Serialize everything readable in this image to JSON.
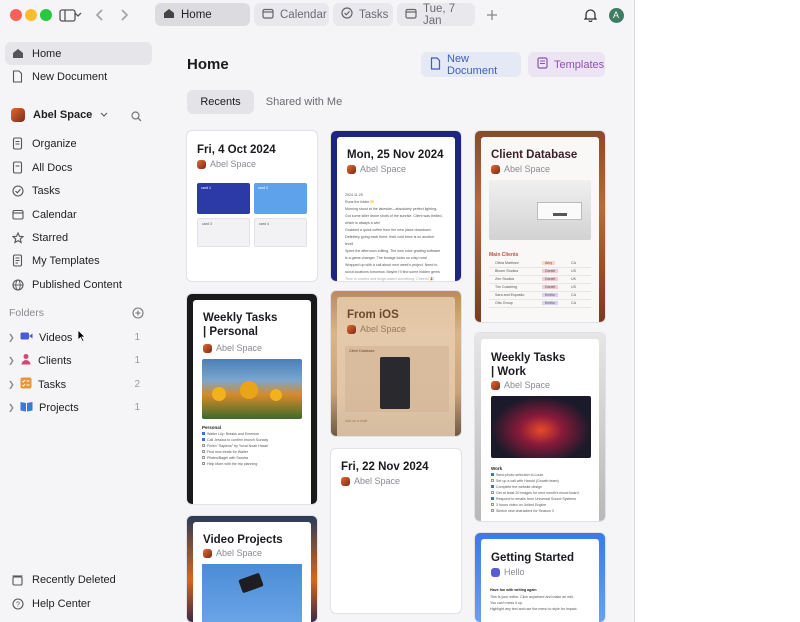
{
  "tabs": [
    {
      "label": "Home",
      "icon": "house-icon"
    },
    {
      "label": "Calendar",
      "icon": "calendar-icon"
    },
    {
      "label": "Tasks",
      "icon": "check-circle-icon"
    },
    {
      "label": "Tue, 7 Jan",
      "icon": "calendar-icon"
    }
  ],
  "avatar_initial": "A",
  "sidebar": {
    "top": [
      {
        "label": "Home"
      },
      {
        "label": "New Document"
      }
    ],
    "space": {
      "label": "Abel Space"
    },
    "nav": [
      {
        "label": "Organize"
      },
      {
        "label": "All Docs"
      },
      {
        "label": "Tasks"
      },
      {
        "label": "Calendar"
      },
      {
        "label": "Starred"
      },
      {
        "label": "My Templates"
      },
      {
        "label": "Published Content"
      }
    ],
    "folders_heading": "Folders",
    "folders": [
      {
        "label": "Videos",
        "count": "1",
        "color": "#4a5bd6"
      },
      {
        "label": "Clients",
        "count": "1",
        "color": "#d6457a"
      },
      {
        "label": "Tasks",
        "count": "2",
        "color": "#e8963a"
      },
      {
        "label": "Projects",
        "count": "1",
        "color": "#3a7ad6"
      }
    ],
    "bottom": [
      {
        "label": "Recently Deleted"
      },
      {
        "label": "Help Center"
      }
    ]
  },
  "main": {
    "title": "Home",
    "new_document": "New Document",
    "templates": "Templates",
    "segments": [
      "Recents",
      "Shared with Me"
    ]
  },
  "cards": {
    "c1": {
      "title": "Fri, 4 Oct 2024",
      "space": "Abel Space",
      "labels": [
        "card 1",
        "card 2",
        "card 3",
        "card 4"
      ]
    },
    "c2": {
      "title": "Mon, 25 Nov 2024",
      "space": "Abel Space",
      "lines": [
        "2024.11.25",
        "Runs the folder 📁",
        "Morning shoot at the lakeside—absolutely perfect lighting.",
        "Got some killer drone shots of the sunrise. Client was thrilled,",
        "which is always a win!",
        "Grabbed a quick coffee from the new place downtown.",
        "Definitely going back there, their cold brew is on another",
        "level!",
        "Spent the afternoon editing. The new color grading software",
        "is a game-changer. The footage looks so crisp now!",
        "Wrapped up with a call about next week's project. Need to",
        "scout locations tomorrow. Maybe I'll find some hidden gems",
        "Time to unwind and binge-watch something. Cheers! 🎉"
      ]
    },
    "c3": {
      "title": "Client Database",
      "space": "Abel Space",
      "section": "Main Clients",
      "rows": [
        {
          "name": "Olivia Martinez",
          "who": "Amy",
          "st": "CA"
        },
        {
          "name": "Bloom Studios",
          "who": "Daniel",
          "st": "US"
        },
        {
          "name": "Zen Studios",
          "who": "Daniel",
          "st": "UK"
        },
        {
          "name": "Tim Coaching",
          "who": "Daniel",
          "st": "US"
        },
        {
          "name": "Sara and Esposito",
          "who": "Emilio",
          "st": "CA"
        },
        {
          "name": "Otto Group",
          "who": "Emilio",
          "st": "CA"
        }
      ]
    },
    "c4": {
      "title_1": "Weekly Tasks",
      "title_2": "| Personal",
      "space": "Abel Space",
      "section": "Personal",
      "items": [
        "Walter Lily: Breaks and Emerson",
        "Call Jessica to confirm brunch Sunday",
        "Finish \"Sapiens\" by Yuval Noah Harari",
        "Find new treats for Walter",
        "Pilates/Bagel with Sandra",
        "Help Mom with the trip planning"
      ]
    },
    "c5": {
      "title": "From iOS",
      "space": "Abel Space",
      "sub": "Client Database",
      "foot": "Add as a draft"
    },
    "c6": {
      "title_1": "Weekly Tasks",
      "title_2": "| Work",
      "space": "Abel Space",
      "section": "Work",
      "items": [
        "Send photo selection to Louie",
        "Set up a call with Harold (Growth team)",
        "Complete the website design",
        "Get at least 20 images for next month's mood board",
        "Respond to emails from Universal Sound Systems",
        "3 hours video on United Engine",
        "Sketch new characters for Season 3"
      ]
    },
    "c7": {
      "title": "Fri, 22 Nov 2024",
      "space": "Abel Space"
    },
    "c8": {
      "title": "Video Projects",
      "space": "Abel Space"
    },
    "c9": {
      "title": "Getting Started",
      "space": "Hello",
      "lines": [
        "Have fun with writing again",
        "This is your editor. Click anywhere and make an edit.",
        "You can't mess it up.",
        "Highlight any text and use the menu to style for impact."
      ]
    }
  }
}
